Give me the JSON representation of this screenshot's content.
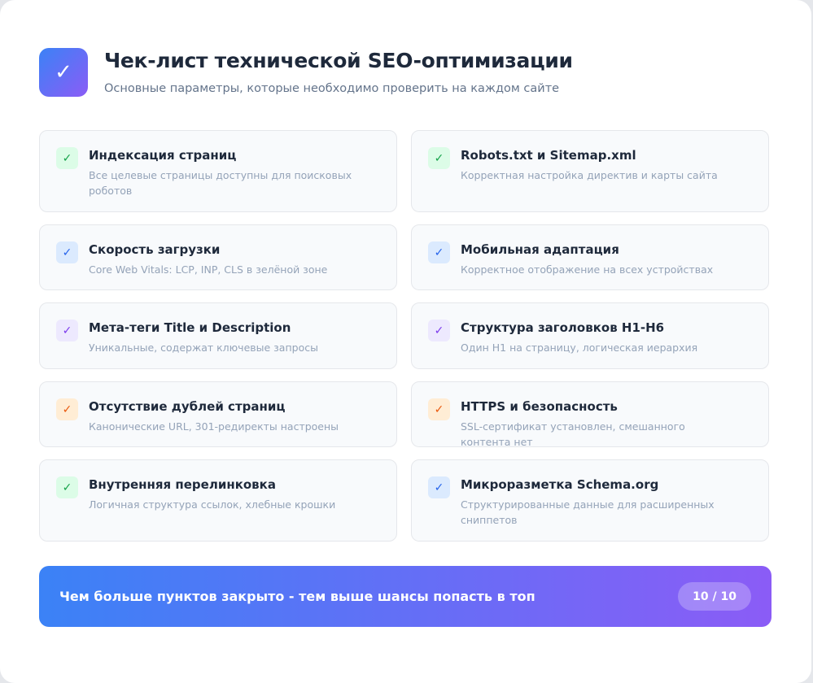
{
  "header": {
    "logo_glyph": "✓",
    "title": "Чек-лист технической SEO-оптимизации",
    "subtitle": "Основные параметры, которые необходимо проверить на каждом сайте"
  },
  "items": [
    {
      "title": "Индексация страниц",
      "description": "Все целевые страницы доступны для поисковых роботов",
      "check_glyph": "✓",
      "check_color": "#16a34a"
    },
    {
      "title": "Robots.txt и Sitemap.xml",
      "description": "Корректная настройка директив и карты сайта",
      "check_glyph": "✓",
      "check_color": "#16a34a"
    },
    {
      "title": "Скорость загрузки",
      "description": "Core Web Vitals: LCP, INP, CLS в зелёной зоне",
      "check_glyph": "✓",
      "check_color": "#2563eb"
    },
    {
      "title": "Мобильная адаптация",
      "description": "Корректное отображение на всех устройствах",
      "check_glyph": "✓",
      "check_color": "#2563eb"
    },
    {
      "title": "Мета-теги Title и Description",
      "description": "Уникальные, содержат ключевые запросы",
      "check_glyph": "✓",
      "check_color": "#7c3aed"
    },
    {
      "title": "Структура заголовков H1-H6",
      "description": "Один H1 на страницу, логическая иерархия",
      "check_glyph": "✓",
      "check_color": "#7c3aed"
    },
    {
      "title": "Отсутствие дублей страниц",
      "description": "Канонические URL, 301-редиректы настроены",
      "check_glyph": "✓",
      "check_color": "#ea580c"
    },
    {
      "title": "HTTPS и безопасность",
      "description": "SSL-сертификат установлен, смешанного контента нет",
      "check_glyph": "✓",
      "check_color": "#ea580c"
    },
    {
      "title": "Внутренняя перелинковка",
      "description": "Логичная структура ссылок, хлебные крошки",
      "check_glyph": "✓",
      "check_color": "#16a34a"
    },
    {
      "title": "Микроразметка Schema.org",
      "description": "Структурированные данные для расширенных сниппетов",
      "check_glyph": "✓",
      "check_color": "#2563eb"
    }
  ],
  "banner": {
    "text": "Чем больше пунктов закрыто - тем выше шансы попасть в топ",
    "score": "10 / 10",
    "accent_start": "#3b82f6",
    "accent_end": "#8b5cf6"
  }
}
